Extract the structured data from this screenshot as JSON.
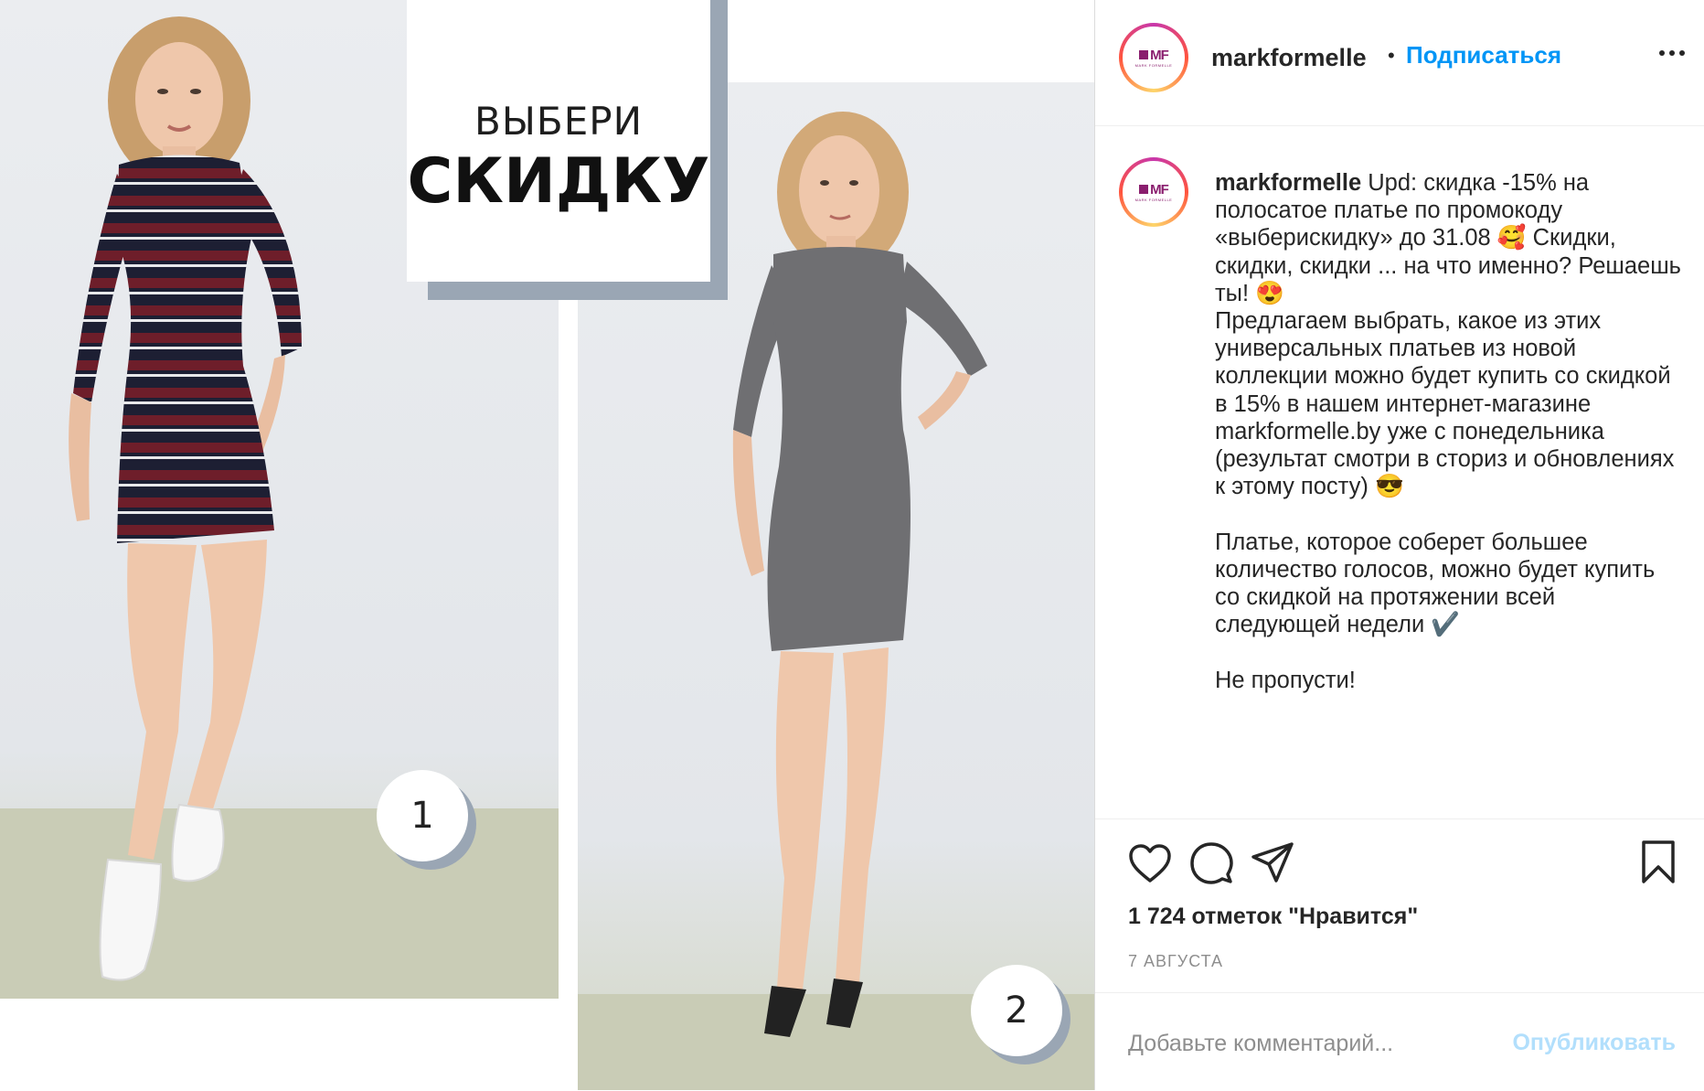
{
  "media": {
    "title_line1": "ВЫБЕРИ",
    "title_line2": "СКИДКУ",
    "badge1": "1",
    "badge2": "2",
    "colors": {
      "accent_box_shadow": "#9aa6b4",
      "dress1_maroon": "#6e1e2a",
      "dress1_navy": "#1d1f33",
      "dress2_grey": "#6f6f72"
    }
  },
  "post": {
    "username": "markformelle",
    "separator": "•",
    "follow_label": "Подписаться",
    "caption_username": "markformelle",
    "caption_body": " Upd: скидка -15% на полосатое платье по промокоду «выберискидку» до 31.08 🥰 Скидки, скидки, скидки ... на что именно? Решаешь ты! 😍\nПредлагаем выбрать, какое из этих универсальных платьев из новой коллекции можно будет купить со скидкой в 15% в нашем интернет-магазине markformelle.by уже с понедельника (результат смотри в сториз и обновлениях к этому посту) 😎\n\nПлатье, которое соберет большее количество голосов, можно будет купить со скидкой на протяжении всей следующей недели ✔️\n\nНе пропусти!",
    "likes": "1 724 отметок \"Нравится\"",
    "date": "7 АВГУСТА",
    "comment_placeholder": "Добавьте комментарий...",
    "publish_label": "Опубликовать",
    "logo_text": "MF",
    "logo_sub": "MARK FORMELLE",
    "colors": {
      "link_blue": "#0095f6",
      "publish_disabled": "#b2dffc",
      "muted": "#8e8e8e"
    },
    "icons": [
      "heart-icon",
      "comment-icon",
      "share-icon",
      "bookmark-icon",
      "more-icon"
    ]
  }
}
